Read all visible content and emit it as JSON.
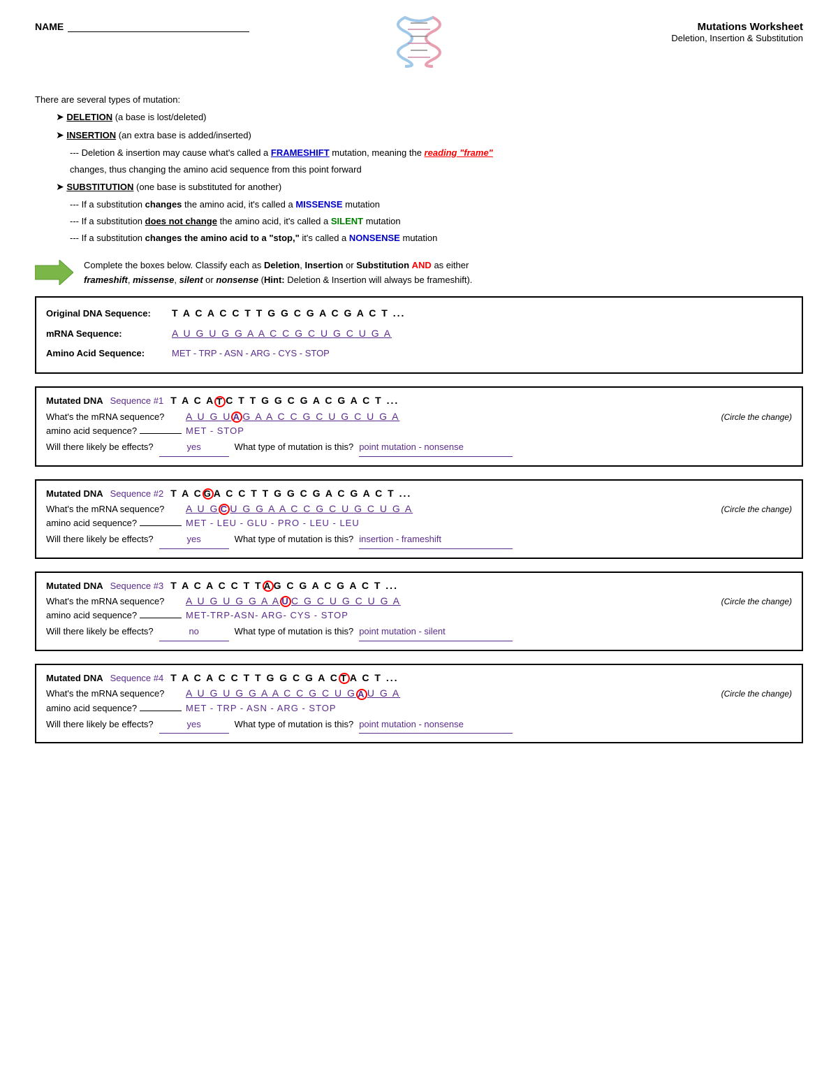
{
  "header": {
    "name_label": "NAME",
    "title": "Mutations Worksheet",
    "subtitle": "Deletion, Insertion & Substitution"
  },
  "intro": {
    "opening": "There are several types of mutation:",
    "deletion_label": "DELETION",
    "deletion_desc": "(a base is lost/deleted)",
    "insertion_label": "INSERTION",
    "insertion_desc": "(an extra base is added/inserted)",
    "frameshift_note": "--- Deletion & insertion may cause what's called a",
    "frameshift_word": "FRAMESHIFT",
    "frameshift_mid": "mutation, meaning the",
    "reading_frame": "reading \"frame\"",
    "frameshift_end": "changes, thus changing the amino acid sequence from this point forward",
    "substitution_label": "SUBSTITUTION",
    "substitution_desc": "(one base is substituted for another)",
    "sub_note1_pre": "--- If a substitution",
    "sub_note1_bold": "changes",
    "sub_note1_mid": "the amino acid, it's called a",
    "sub_note1_word": "MISSENSE",
    "sub_note1_end": "mutation",
    "sub_note2_pre": "--- If a substitution",
    "sub_note2_bold": "does not change",
    "sub_note2_mid": "the amino acid, it's called a",
    "sub_note2_word": "SILENT",
    "sub_note2_end": "mutation",
    "sub_note3_pre": "--- If a substitution",
    "sub_note3_bold": "changes the amino acid to a \"stop,\"",
    "sub_note3_mid": "it's called a",
    "sub_note3_word": "NONSENSE",
    "sub_note3_end": "mutation"
  },
  "arrow_instruction": {
    "line1_pre": "Complete the boxes below.  Classify each as",
    "line1_bold1": "Deletion",
    "line1_mid1": ",",
    "line1_bold2": "Insertion",
    "line1_mid2": "or",
    "line1_bold3": "Substitution",
    "line1_and": "AND",
    "line1_end": "as either",
    "line2_b1": "frameshift",
    "line2_mid1": ",",
    "line2_b2": "missense",
    "line2_mid2": ",",
    "line2_b3": "silent",
    "line2_mid3": "or",
    "line2_b4": "nonsense",
    "line2_hint": "Hint:",
    "line2_end": "Deletion & Insertion will always be frameshift)."
  },
  "original": {
    "label": "Original DNA Sequence:",
    "dna": "T A C A C C T T G G C G A C G A C T ...",
    "mrna_label": "mRNA Sequence:",
    "mrna": "A U G U G G A A C C G C U G C U G A",
    "amino_label": "Amino Acid Sequence:",
    "amino": "MET - TRP - ASN - ARG - CYS - STOP"
  },
  "mutation1": {
    "label": "Mutated DNA",
    "seq_num": "Sequence #1",
    "dna_pre": "T A C A",
    "dna_circled": "T",
    "dna_post": "C T T G G C G A C G A C T ...",
    "mrna_label": "What's the mRNA sequence?",
    "mrna_pre": "A U G U",
    "mrna_circled": "A",
    "mrna_post": "G A A C C G C U G C U G A",
    "circle_note": "(Circle the change)",
    "amino_label": "amino acid sequence?",
    "amino": "MET - STOP",
    "effects_label": "Will there likely be effects?",
    "effects_answer": "yes",
    "mutation_type_label": "What type of mutation is this?",
    "mutation_type": "point mutation - nonsense"
  },
  "mutation2": {
    "label": "Mutated DNA",
    "seq_num": "Sequence #2",
    "dna_pre": "T A C",
    "dna_circled": "G",
    "dna_post": "A C C T T G G C G A C G A C T ...",
    "mrna_label": "What's the mRNA sequence?",
    "mrna_pre": "A U G",
    "mrna_circled": "C",
    "mrna_post": "U G G A A C C G C U G C U G A",
    "circle_note": "(Circle the change)",
    "amino_label": "amino acid sequence?",
    "amino": "MET - LEU - GLU - PRO - LEU - LEU",
    "effects_label": "Will there likely be effects?",
    "effects_answer": "yes",
    "mutation_type_label": "What type of mutation is this?",
    "mutation_type": "insertion - frameshift"
  },
  "mutation3": {
    "label": "Mutated DNA",
    "seq_num": "Sequence #3",
    "dna_pre": "T A C A C C T T",
    "dna_circled": "A",
    "dna_post": "G C G A C G A C T ...",
    "mrna_label": "What's the mRNA sequence?",
    "mrna_pre": "A U G U G G A A",
    "mrna_circled": "U",
    "mrna_post": "C G C U G C U G A",
    "circle_note": "(Circle the change)",
    "amino_label": "amino acid sequence?",
    "amino": "MET-TRP-ASN- ARG- CYS - STOP",
    "effects_label": "Will there likely be effects?",
    "effects_answer": "no",
    "mutation_type_label": "What type of mutation is this?",
    "mutation_type": "point mutation - silent"
  },
  "mutation4": {
    "label": "Mutated DNA",
    "seq_num": "Sequence #4",
    "dna_pre": "T A C A C C T T G G C G A C",
    "dna_circled": "T",
    "dna_post": "A C T ...",
    "mrna_label": "What's the mRNA sequence?",
    "mrna_pre": "A U G U G G A A C C G C U G",
    "mrna_circled": "A",
    "mrna_post": "U G A",
    "circle_note": "(Circle the change)",
    "amino_label": "amino acid sequence?",
    "amino": "MET - TRP - ASN - ARG - STOP",
    "effects_label": "Will there likely be effects?",
    "effects_answer": "yes",
    "mutation_type_label": "What type of mutation is this?",
    "mutation_type": "point mutation - nonsense"
  }
}
